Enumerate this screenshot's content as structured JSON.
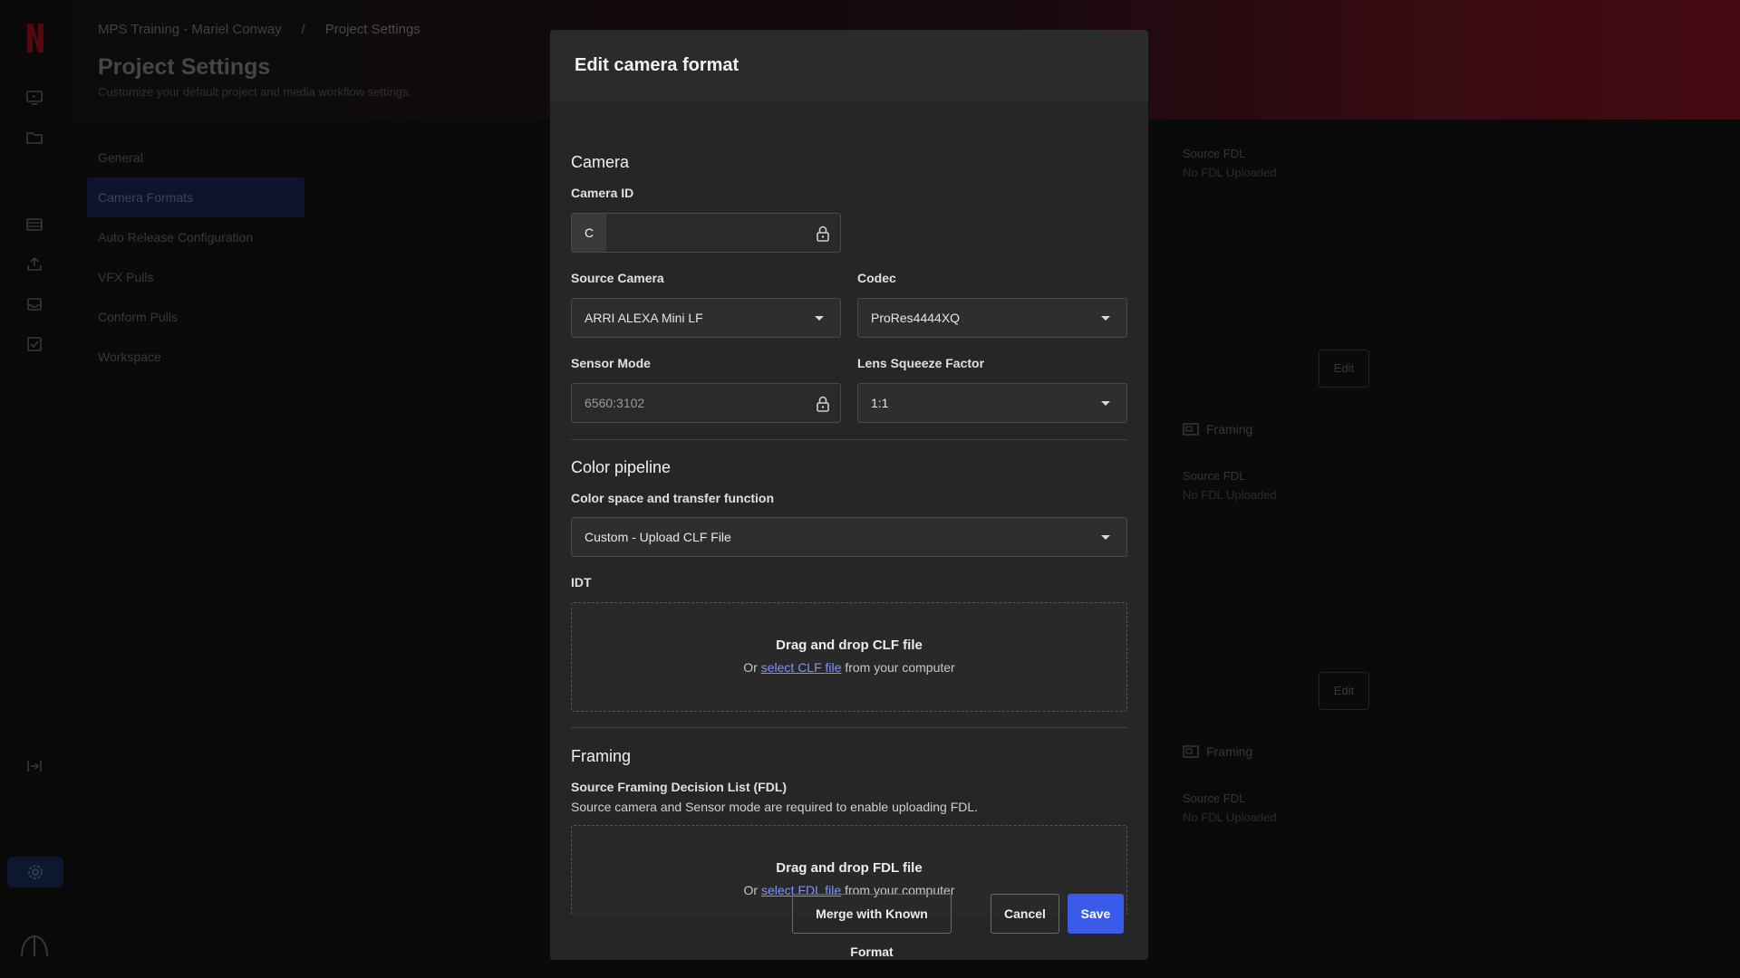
{
  "background": {
    "breadcrumb": [
      "MPS Training - Mariel Conway",
      "/",
      "Project Settings"
    ],
    "page_title": "Project Settings",
    "page_subtitle": "Customize your default project and media workflow settings.",
    "nav": [
      "General",
      "Camera Formats",
      "Auto Release Configuration",
      "VFX Pulls",
      "Conform Pulls",
      "Workspace"
    ],
    "right_panel": {
      "source_fdl_label": "Source FDL",
      "source_fdl_value": "No FDL Uploaded",
      "framing_label": "Framing",
      "edit_label": "Edit"
    }
  },
  "modal": {
    "title": "Edit camera format",
    "camera": {
      "section_title": "Camera",
      "camera_id_label": "Camera ID",
      "camera_id_value": "C",
      "source_camera_label": "Source Camera",
      "source_camera_value": "ARRI ALEXA Mini LF",
      "codec_label": "Codec",
      "codec_value": "ProRes4444XQ",
      "sensor_mode_label": "Sensor Mode",
      "sensor_mode_value": "6560:3102",
      "lens_squeeze_label": "Lens Squeeze Factor",
      "lens_squeeze_value": "1:1"
    },
    "color": {
      "section_title": "Color pipeline",
      "colorspace_label": "Color space and transfer function",
      "colorspace_value": "Custom - Upload CLF File",
      "idt_label": "IDT",
      "clf_drop_title": "Drag and drop CLF file",
      "clf_or": "Or ",
      "clf_link": "select CLF file",
      "clf_suffix": " from your computer"
    },
    "framing": {
      "section_title": "Framing",
      "fdl_label": "Source Framing Decision List (FDL)",
      "fdl_hint": "Source camera and Sensor mode are required to enable uploading FDL.",
      "fdl_drop_title": "Drag and drop FDL file",
      "fdl_or": "Or ",
      "fdl_link": "select FDL file",
      "fdl_suffix": " from your computer"
    },
    "footer": {
      "merge_label": "Merge with Known Format",
      "cancel_label": "Cancel",
      "save_label": "Save"
    }
  },
  "colors": {
    "primary": "#3a5bea",
    "link": "#7f93ff",
    "modal_bg": "#262626",
    "brand_red": "#e50914"
  },
  "icons": [
    "netflix-logo",
    "monitor-icon",
    "folder-icon",
    "film-icon",
    "upload-icon",
    "inbox-icon",
    "checklist-icon",
    "collapse-icon",
    "gear-icon",
    "avatar-icon",
    "lock-icon",
    "framing-icon"
  ]
}
